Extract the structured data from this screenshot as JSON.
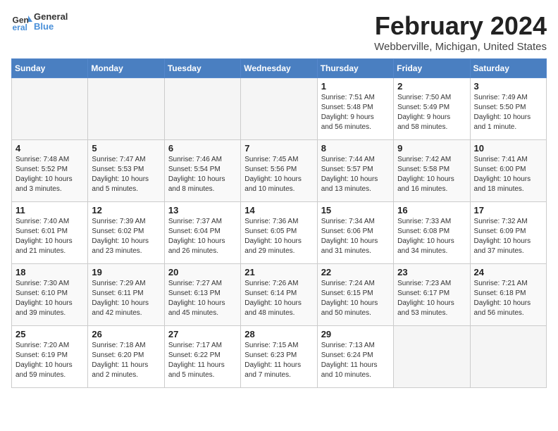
{
  "header": {
    "logo_line1": "General",
    "logo_line2": "Blue",
    "month_year": "February 2024",
    "location": "Webberville, Michigan, United States"
  },
  "days_of_week": [
    "Sunday",
    "Monday",
    "Tuesday",
    "Wednesday",
    "Thursday",
    "Friday",
    "Saturday"
  ],
  "weeks": [
    [
      {
        "day": "",
        "info": ""
      },
      {
        "day": "",
        "info": ""
      },
      {
        "day": "",
        "info": ""
      },
      {
        "day": "",
        "info": ""
      },
      {
        "day": "1",
        "info": "Sunrise: 7:51 AM\nSunset: 5:48 PM\nDaylight: 9 hours\nand 56 minutes."
      },
      {
        "day": "2",
        "info": "Sunrise: 7:50 AM\nSunset: 5:49 PM\nDaylight: 9 hours\nand 58 minutes."
      },
      {
        "day": "3",
        "info": "Sunrise: 7:49 AM\nSunset: 5:50 PM\nDaylight: 10 hours\nand 1 minute."
      }
    ],
    [
      {
        "day": "4",
        "info": "Sunrise: 7:48 AM\nSunset: 5:52 PM\nDaylight: 10 hours\nand 3 minutes."
      },
      {
        "day": "5",
        "info": "Sunrise: 7:47 AM\nSunset: 5:53 PM\nDaylight: 10 hours\nand 5 minutes."
      },
      {
        "day": "6",
        "info": "Sunrise: 7:46 AM\nSunset: 5:54 PM\nDaylight: 10 hours\nand 8 minutes."
      },
      {
        "day": "7",
        "info": "Sunrise: 7:45 AM\nSunset: 5:56 PM\nDaylight: 10 hours\nand 10 minutes."
      },
      {
        "day": "8",
        "info": "Sunrise: 7:44 AM\nSunset: 5:57 PM\nDaylight: 10 hours\nand 13 minutes."
      },
      {
        "day": "9",
        "info": "Sunrise: 7:42 AM\nSunset: 5:58 PM\nDaylight: 10 hours\nand 16 minutes."
      },
      {
        "day": "10",
        "info": "Sunrise: 7:41 AM\nSunset: 6:00 PM\nDaylight: 10 hours\nand 18 minutes."
      }
    ],
    [
      {
        "day": "11",
        "info": "Sunrise: 7:40 AM\nSunset: 6:01 PM\nDaylight: 10 hours\nand 21 minutes."
      },
      {
        "day": "12",
        "info": "Sunrise: 7:39 AM\nSunset: 6:02 PM\nDaylight: 10 hours\nand 23 minutes."
      },
      {
        "day": "13",
        "info": "Sunrise: 7:37 AM\nSunset: 6:04 PM\nDaylight: 10 hours\nand 26 minutes."
      },
      {
        "day": "14",
        "info": "Sunrise: 7:36 AM\nSunset: 6:05 PM\nDaylight: 10 hours\nand 29 minutes."
      },
      {
        "day": "15",
        "info": "Sunrise: 7:34 AM\nSunset: 6:06 PM\nDaylight: 10 hours\nand 31 minutes."
      },
      {
        "day": "16",
        "info": "Sunrise: 7:33 AM\nSunset: 6:08 PM\nDaylight: 10 hours\nand 34 minutes."
      },
      {
        "day": "17",
        "info": "Sunrise: 7:32 AM\nSunset: 6:09 PM\nDaylight: 10 hours\nand 37 minutes."
      }
    ],
    [
      {
        "day": "18",
        "info": "Sunrise: 7:30 AM\nSunset: 6:10 PM\nDaylight: 10 hours\nand 39 minutes."
      },
      {
        "day": "19",
        "info": "Sunrise: 7:29 AM\nSunset: 6:11 PM\nDaylight: 10 hours\nand 42 minutes."
      },
      {
        "day": "20",
        "info": "Sunrise: 7:27 AM\nSunset: 6:13 PM\nDaylight: 10 hours\nand 45 minutes."
      },
      {
        "day": "21",
        "info": "Sunrise: 7:26 AM\nSunset: 6:14 PM\nDaylight: 10 hours\nand 48 minutes."
      },
      {
        "day": "22",
        "info": "Sunrise: 7:24 AM\nSunset: 6:15 PM\nDaylight: 10 hours\nand 50 minutes."
      },
      {
        "day": "23",
        "info": "Sunrise: 7:23 AM\nSunset: 6:17 PM\nDaylight: 10 hours\nand 53 minutes."
      },
      {
        "day": "24",
        "info": "Sunrise: 7:21 AM\nSunset: 6:18 PM\nDaylight: 10 hours\nand 56 minutes."
      }
    ],
    [
      {
        "day": "25",
        "info": "Sunrise: 7:20 AM\nSunset: 6:19 PM\nDaylight: 10 hours\nand 59 minutes."
      },
      {
        "day": "26",
        "info": "Sunrise: 7:18 AM\nSunset: 6:20 PM\nDaylight: 11 hours\nand 2 minutes."
      },
      {
        "day": "27",
        "info": "Sunrise: 7:17 AM\nSunset: 6:22 PM\nDaylight: 11 hours\nand 5 minutes."
      },
      {
        "day": "28",
        "info": "Sunrise: 7:15 AM\nSunset: 6:23 PM\nDaylight: 11 hours\nand 7 minutes."
      },
      {
        "day": "29",
        "info": "Sunrise: 7:13 AM\nSunset: 6:24 PM\nDaylight: 11 hours\nand 10 minutes."
      },
      {
        "day": "",
        "info": ""
      },
      {
        "day": "",
        "info": ""
      }
    ]
  ]
}
